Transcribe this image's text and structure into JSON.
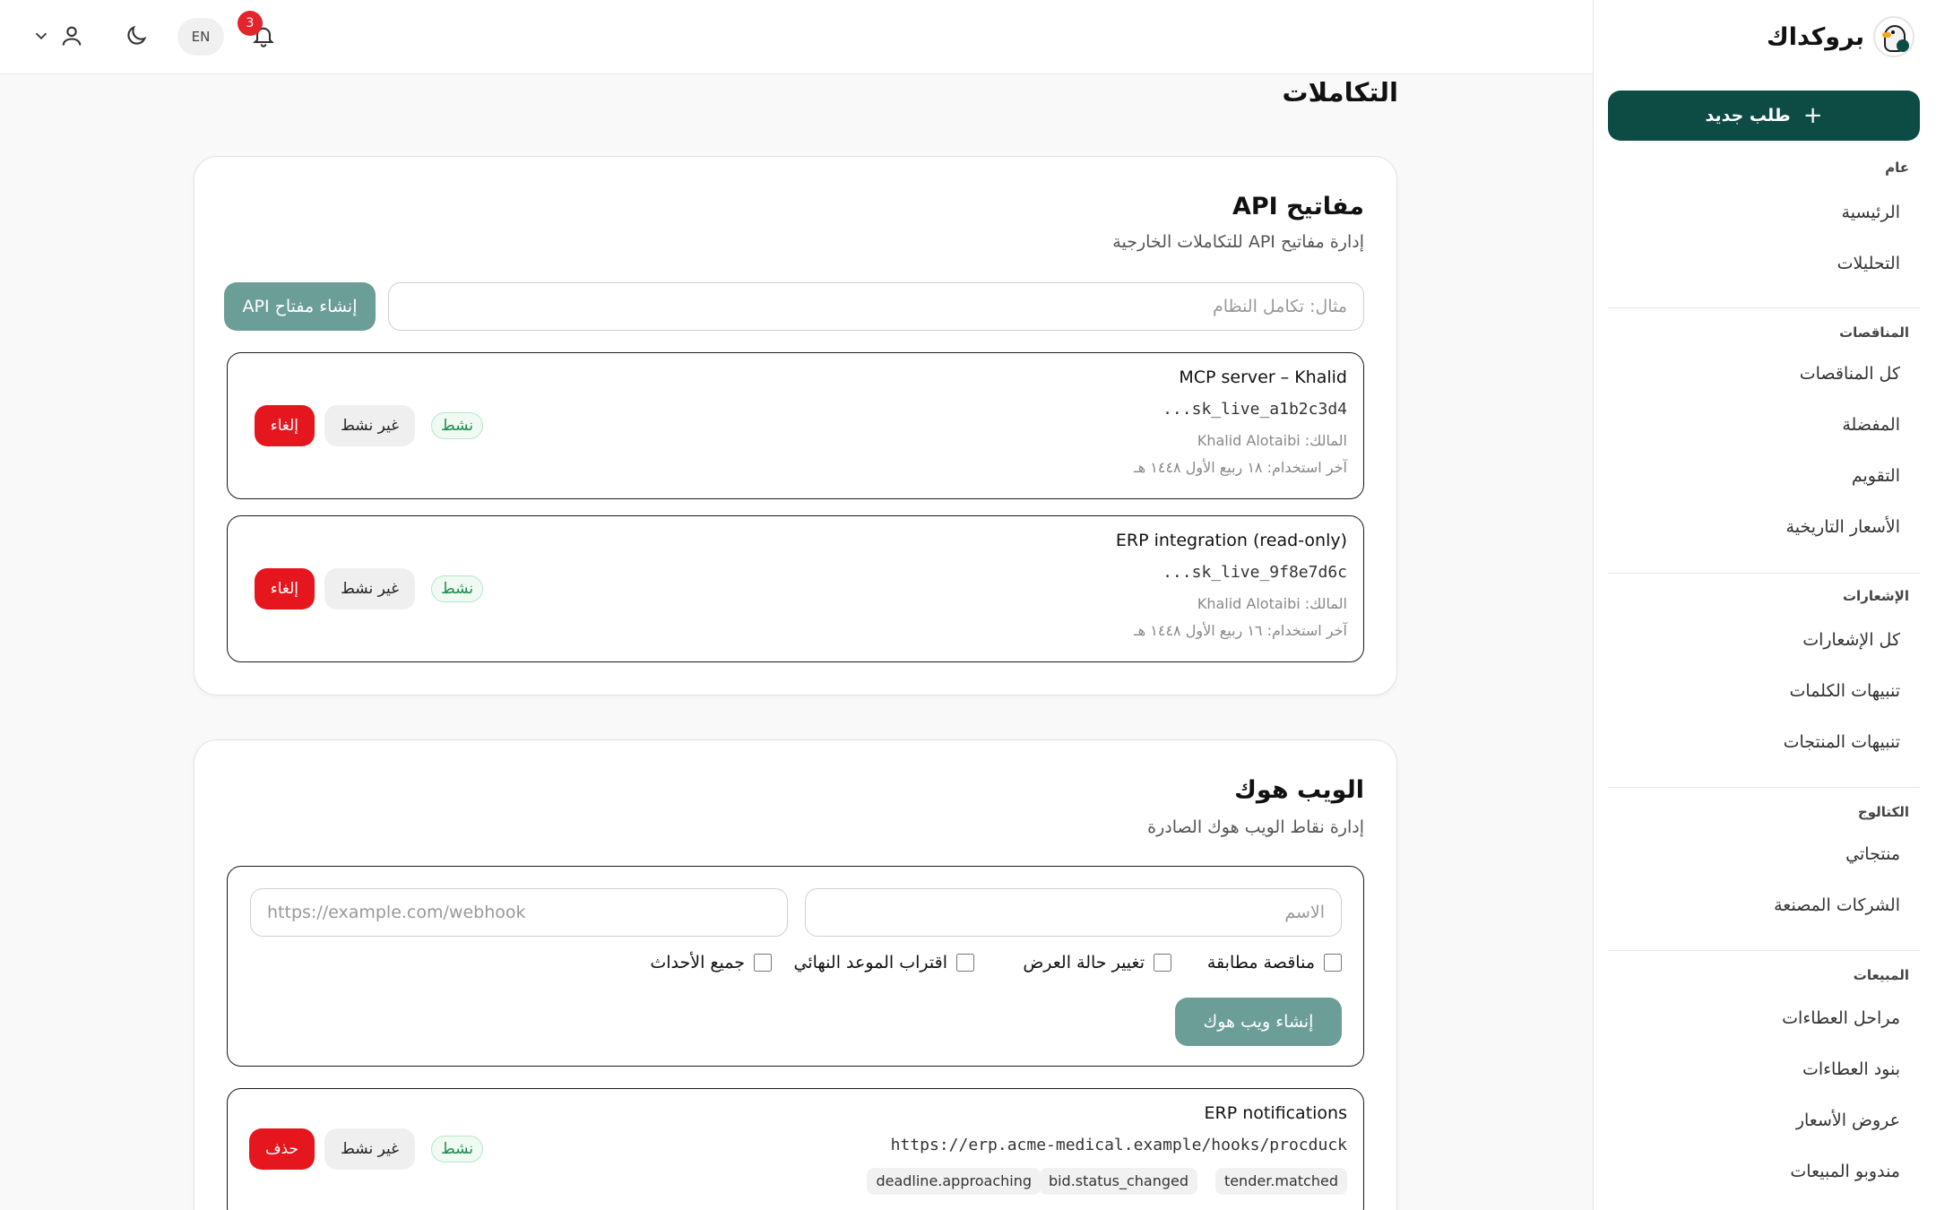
{
  "app": {
    "brand_name": "بروكداك",
    "new_request_label": "طلب جديد"
  },
  "topbar": {
    "language_label": "EN",
    "notification_count": "3"
  },
  "sidebar": {
    "sections": [
      {
        "heading": "عام",
        "items": [
          "الرئيسية",
          "التحليلات"
        ]
      },
      {
        "heading": "المناقصات",
        "items": [
          "كل المناقصات",
          "المفضلة",
          "التقويم",
          "الأسعار التاريخية"
        ]
      },
      {
        "heading": "الإشعارات",
        "items": [
          "كل الإشعارات",
          "تنبيهات الكلمات",
          "تنبيهات المنتجات"
        ]
      },
      {
        "heading": "الكتالوج",
        "items": [
          "منتجاتي",
          "الشركات المصنعة"
        ]
      },
      {
        "heading": "المبيعات",
        "items": [
          "مراحل العطاءات",
          "بنود العطاءات",
          "عروض الأسعار",
          "مندوبو المبيعات"
        ]
      }
    ]
  },
  "page": {
    "title": "التكاملات"
  },
  "api_keys": {
    "title": "مفاتيح API",
    "subtitle": "إدارة مفاتيح API للتكاملات الخارجية",
    "name_placeholder": "مثال: تكامل النظام",
    "create_label": "إنشاء مفتاح API",
    "keys": [
      {
        "name": "MCP server – Khalid",
        "key": "...sk_live_a1b2c3d4",
        "owner": "المالك: Khalid Alotaibi",
        "last_used": "آخر استخدام: ١٨ ربيع الأول ١٤٤٨ هـ",
        "status": "نشط",
        "deactivate_label": "غير نشط",
        "revoke_label": "إلغاء"
      },
      {
        "name": "ERP integration (read-only)",
        "key": "...sk_live_9f8e7d6c",
        "owner": "المالك: Khalid Alotaibi",
        "last_used": "آخر استخدام: ١٦ ربيع الأول ١٤٤٨ هـ",
        "status": "نشط",
        "deactivate_label": "غير نشط",
        "revoke_label": "إلغاء"
      }
    ]
  },
  "webhooks": {
    "title": "الويب هوك",
    "subtitle": "إدارة نقاط الويب هوك الصادرة",
    "name_placeholder": "الاسم",
    "url_placeholder": "https://example.com/webhook",
    "events": [
      "مناقصة مطابقة",
      "تغيير حالة العرض",
      "اقتراب الموعد النهائي",
      "جميع الأحداث"
    ],
    "create_label": "إنشاء ويب هوك",
    "items": [
      {
        "name": "ERP notifications",
        "url": "https://erp.acme-medical.example/hooks/procduck",
        "tags": [
          "tender.matched",
          "bid.status_changed",
          "deadline.approaching"
        ],
        "status": "نشط",
        "deactivate_label": "غير نشط",
        "delete_label": "حذف"
      }
    ]
  },
  "colors": {
    "primary": "#0d4c45",
    "create_button": "#6b9e97",
    "danger": "#e5161d",
    "active_badge_text": "#1f8a4c",
    "notification_badge": "#e5232a"
  }
}
